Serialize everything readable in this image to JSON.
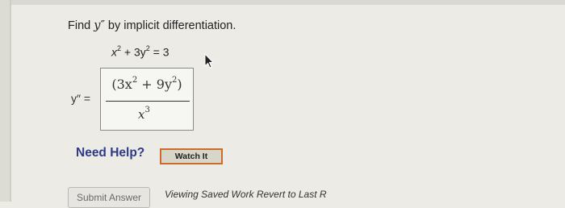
{
  "question": {
    "prefix": "Find ",
    "var": "y″",
    "suffix": " by implicit differentiation."
  },
  "given": {
    "x_base": "x",
    "x_exp": "2",
    "mid": " + 3y",
    "y_exp": "2",
    "rhs": " = 3"
  },
  "answer": {
    "label": "y″ =",
    "num_open": "(3x",
    "num_exp1": "2",
    "num_mid": " + 9y",
    "num_exp2": "2",
    "num_close": ")",
    "den_base": "x",
    "den_exp": "3"
  },
  "help": {
    "label": "Need Help?",
    "watch_label": "Watch It"
  },
  "footer": {
    "submit_label": "Submit Answer",
    "saved_text": "Viewing Saved Work Revert to Last R"
  },
  "icons": [
    "pointer-cursor-icon"
  ]
}
